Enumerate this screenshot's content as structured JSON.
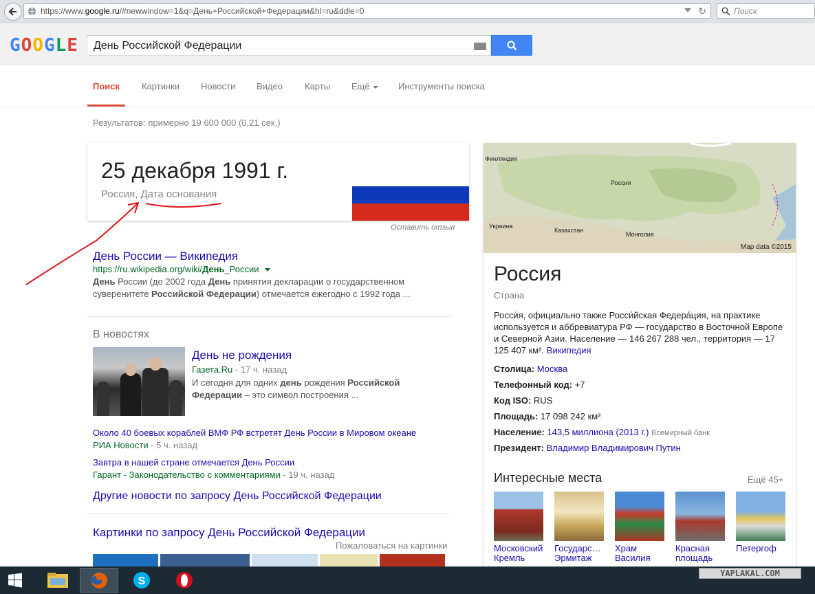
{
  "browser": {
    "url_prefix": "https://www.",
    "url_domain": "google.ru",
    "url_rest": "/#newwindow=1&q=День+Российской+Федерации&hl=ru&ddle=0",
    "search_placeholder": "Поиск"
  },
  "google": {
    "logo_text": "GOOGLE",
    "query": "День Российской Федерации",
    "tabs": [
      "Поиск",
      "Картинки",
      "Новости",
      "Видео",
      "Карты",
      "Ещё",
      "Инструменты поиска"
    ],
    "stats": "Результатов: примерно 19 600 000 (0,21 сек.)"
  },
  "answer": {
    "value": "25 декабря 1991 г.",
    "subject": "Россия, Дата основания",
    "feedback": "Оставить отзыв",
    "flag_colors": [
      "#ffffff",
      "#0c3ab8",
      "#d52b1e"
    ]
  },
  "result1": {
    "title": "День России — Википедия",
    "url_a": "https://ru.wikipedia.org/wiki/",
    "url_b": "День",
    "url_c": "_России",
    "snip1_a": "День",
    "snip1_b": " России (до 2002 года ",
    "snip1_c": "День",
    "snip1_d": " принятия декларации о государственном",
    "snip2_a": "суверенитете ",
    "snip2_b": "Российской Федерации",
    "snip2_c": ") отмечается ежегодно с 1992 года ..."
  },
  "news": {
    "heading": "В новостях",
    "top_title": "День не рождения",
    "top_source": "Газета.Ru",
    "top_ago": " - 17 ч. назад",
    "top_snip1_a": "И сегодня для одних ",
    "top_snip1_b": "день",
    "top_snip1_c": " рождения ",
    "top_snip1_d": "Российской",
    "top_snip2_a": "Федерации",
    "top_snip2_b": " – это символ построения ...",
    "item2_title": "Около 40 боевых кораблей ВМФ РФ встретят День России в Мировом океане",
    "item2_source": "РИА Новости",
    "item2_ago": " - 5 ч. назад",
    "item3_title": "Завтра в нашей стране отмечается День России",
    "item3_source": "Гарант - Законодательство с комментариями",
    "item3_ago": " - 19 ч. назад",
    "more": "Другие новости по запросу День Российской Федерации"
  },
  "images": {
    "title": "Картинки по запросу День Российской Федерации",
    "report": "Пожаловаться на картинки"
  },
  "kpanel": {
    "map_labels": [
      "Финляндия",
      "Россия",
      "Украина",
      "Казахстан",
      "Монголия"
    ],
    "map_data": "Map data ©2015",
    "title": "Россия",
    "subtitle": "Страна",
    "desc1": "Росси́я, официально также Росси́йская Федера́ция, на практике",
    "desc2": "используется и аббревиатура РФ — государство в Восточной Европе",
    "desc3": "и Северной Азии. Население — 146 267 288 чел., территория — 17",
    "desc4": "125 407 км².",
    "desc_link": "Википедия",
    "facts": [
      {
        "label": "Столица:",
        "value": "Москва"
      },
      {
        "label": "Телефонный код:",
        "value": "+7"
      },
      {
        "label": "Код ISO:",
        "value": "RUS"
      },
      {
        "label": "Площадь:",
        "value": "17 098 242 км²"
      },
      {
        "label": "Население:",
        "value": "143,5 миллиона (2013 г.)",
        "note": "Всемирный банк"
      },
      {
        "label": "Президент:",
        "value": "Владимир Владимирович Путин"
      }
    ],
    "interesting": "Интересные места",
    "more": "Ещё 45+",
    "places": [
      {
        "name1": "Московский",
        "name2": "Кремль"
      },
      {
        "name1": "Государс…",
        "name2": "Эрмитаж"
      },
      {
        "name1": "Храм",
        "name2": "Василия"
      },
      {
        "name1": "Красная",
        "name2": "площадь"
      },
      {
        "name1": "Петергоф",
        "name2": ""
      }
    ]
  },
  "watermark": "YAPLAKAL.COM"
}
